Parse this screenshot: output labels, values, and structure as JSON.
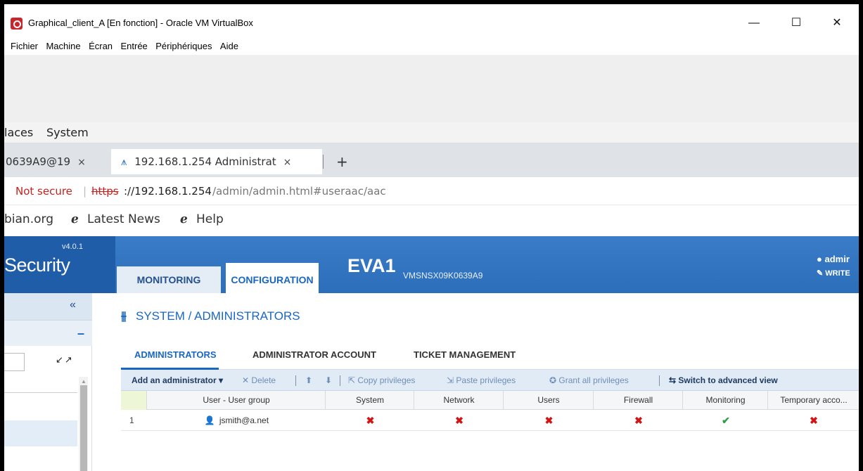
{
  "vbox": {
    "title": "Graphical_client_A [En fonction] - Oracle VM VirtualBox",
    "menu": [
      "Fichier",
      "Machine",
      "Écran",
      "Entrée",
      "Périphériques",
      "Aide"
    ],
    "minimize": "—",
    "maximize": "☐",
    "close": "✕"
  },
  "gnome": {
    "places": "laces",
    "system": "System"
  },
  "browser": {
    "tabs": [
      {
        "label": "0639A9@19",
        "close": "×"
      },
      {
        "label": "192.168.1.254 Administrat",
        "close": "×"
      }
    ],
    "new_tab": "+",
    "url": {
      "not_secure": "Not secure",
      "scheme": "https",
      "host": "://192.168.1.254",
      "path": "/admin/admin.html#useraac/aac"
    },
    "bookmarks": {
      "b1": "bian.org",
      "b2": "Latest News",
      "b3": "Help",
      "icon": "ℯ"
    }
  },
  "app": {
    "version": "v4.0.1",
    "brand": "Security",
    "tabs": {
      "monitoring": "MONITORING",
      "configuration": "CONFIGURATION"
    },
    "firewall_name": "EVA1",
    "serial": "VMSNSX09K0639A9",
    "user": "admir",
    "write": "WRITE",
    "left": {
      "collapse": "«",
      "minus": "–",
      "expand": "↙↗"
    },
    "page": {
      "icon": "⫵",
      "title": "SYSTEM / ADMINISTRATORS",
      "subtabs": [
        "ADMINISTRATORS",
        "ADMINISTRATOR ACCOUNT",
        "TICKET MANAGEMENT"
      ],
      "toolbar": {
        "add": "Add an administrator ▾",
        "delete": "✕  Delete",
        "up": "⬆",
        "down": "⬇",
        "copy": "⇱  Copy privileges",
        "paste": "⇲  Paste privileges",
        "grant": "✪  Grant all privileges",
        "switch": "⇆  Switch to advanced view"
      },
      "columns": [
        "User - User group",
        "System",
        "Network",
        "Users",
        "Firewall",
        "Monitoring",
        "Temporary acco..."
      ],
      "rows": [
        {
          "num": "1",
          "user": "jsmith@a.net",
          "system": "✖",
          "network": "✖",
          "users": "✖",
          "firewall": "✖",
          "monitoring": "✔",
          "temporary": "✖"
        }
      ]
    }
  },
  "colors": {
    "accent": "#1a67c3",
    "header": "#2c6eb9",
    "deny": "#d21414",
    "allow": "#2e9d4a"
  }
}
